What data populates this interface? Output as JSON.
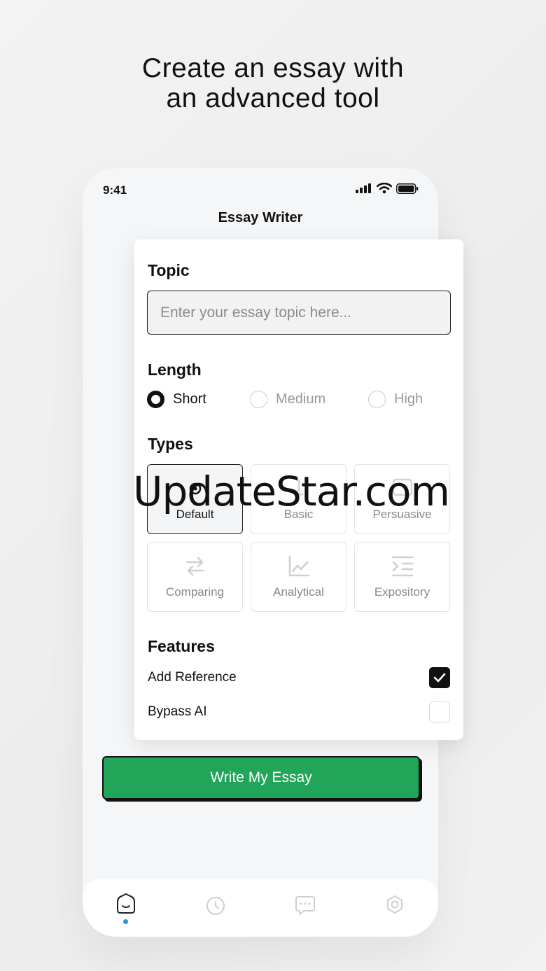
{
  "headline": {
    "line1": "Create an essay with",
    "line2": "an advanced tool"
  },
  "status_bar": {
    "time": "9:41",
    "icons": [
      "signal-icon",
      "wifi-icon",
      "battery-icon"
    ]
  },
  "app": {
    "title": "Essay Writer"
  },
  "form": {
    "topic": {
      "label": "Topic",
      "placeholder": "Enter your essay topic here...",
      "value": ""
    },
    "length": {
      "label": "Length",
      "options": [
        "Short",
        "Medium",
        "High"
      ],
      "selected": "Short"
    },
    "types": {
      "label": "Types",
      "options": [
        {
          "label": "Default",
          "icon": "sparkle-icon"
        },
        {
          "label": "Basic",
          "icon": "pen-icon"
        },
        {
          "label": "Persuasive",
          "icon": "message-icon"
        },
        {
          "label": "Comparing",
          "icon": "arrows-swap-icon"
        },
        {
          "label": "Analytical",
          "icon": "line-chart-icon"
        },
        {
          "label": "Expository",
          "icon": "list-indent-icon"
        }
      ],
      "selected": "Default"
    },
    "features": {
      "label": "Features",
      "items": [
        {
          "label": "Add Reference",
          "checked": true
        },
        {
          "label": "Bypass AI",
          "checked": false
        }
      ]
    }
  },
  "cta": {
    "label": "Write My Essay"
  },
  "tabbar": {
    "tabs": [
      {
        "icon": "home-smile-icon",
        "active": true
      },
      {
        "icon": "clock-icon",
        "active": false
      },
      {
        "icon": "chat-icon",
        "active": false
      },
      {
        "icon": "settings-icon",
        "active": false
      }
    ]
  },
  "watermark": "UpdateStar.com",
  "colors": {
    "accent_green": "#21a559",
    "active_dot": "#2a93e0",
    "background": "#efefef"
  }
}
